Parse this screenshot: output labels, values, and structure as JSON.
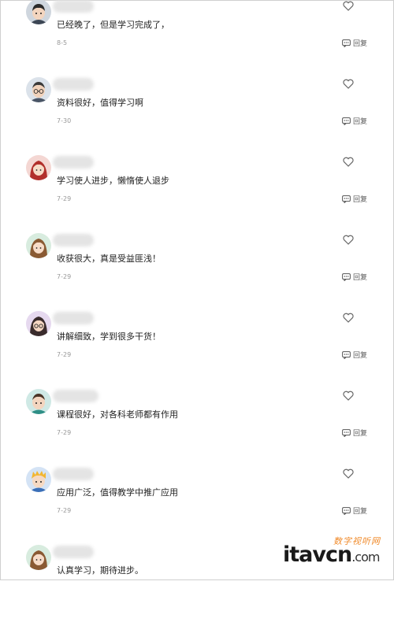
{
  "comments": [
    {
      "text": "已经晚了，但是学习完成了，",
      "date": "8-5",
      "reply_label": "回复",
      "avatar": "man-dark-hair"
    },
    {
      "text": "资料很好，值得学习啊",
      "date": "7-30",
      "reply_label": "回复",
      "avatar": "man-glasses"
    },
    {
      "text": "学习使人进步，懒惰使人退步",
      "date": "7-29",
      "reply_label": "回复",
      "avatar": "woman-red-hair"
    },
    {
      "text": "收获很大，真是受益匪浅！",
      "date": "7-29",
      "reply_label": "回复",
      "avatar": "woman-brown-hair"
    },
    {
      "text": "讲解细致，学到很多干货！",
      "date": "7-29",
      "reply_label": "回复",
      "avatar": "woman-glasses"
    },
    {
      "text": "课程很好，对各科老师都有作用",
      "date": "7-29",
      "reply_label": "回复",
      "avatar": "man-teal"
    },
    {
      "text": "应用广泛，值得教学中推广应用",
      "date": "7-29",
      "reply_label": "回复",
      "avatar": "boy-yellow-hair"
    },
    {
      "text": "认真学习，期待进步。",
      "date": "",
      "reply_label": "",
      "avatar": "woman-brown-hair-2"
    }
  ],
  "icons": {
    "like": "heart-outline-icon",
    "reply": "comment-bubble-icon"
  },
  "watermark": {
    "cn": "数字视听网",
    "brand": "itavcn",
    "suffix": ".com"
  },
  "colors": {
    "accent_watermark": "#f08a2a",
    "date": "#999999"
  }
}
